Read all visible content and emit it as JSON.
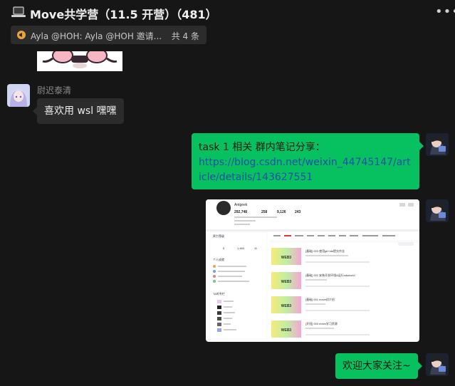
{
  "header": {
    "title": "Move共学营（11.5 开营）（481）",
    "icon": "laptop-icon",
    "more_icon": "more-icon"
  },
  "notice": {
    "text": "Ayla @HOH: Ayla @HOH 邀请...",
    "count": "共 4 条"
  },
  "messages": [
    {
      "side": "left",
      "sender": "尉迟泰清",
      "text": "喜欢用 wsl 嘿嘿"
    },
    {
      "side": "right",
      "text_prefix": "task 1 相关 群内笔记分享：",
      "link": "https://blog.csdn.net/weixin_44745147/article/details/143627551"
    },
    {
      "side": "right",
      "type": "image-screenshot"
    },
    {
      "side": "right",
      "text": "欢迎大家关注~"
    }
  ],
  "profile_shot": {
    "name": "Antgeek",
    "stats": [
      "292,748",
      "258",
      "9,126",
      "243"
    ],
    "posts": [
      "[基础] 003 使用git+ide提交作业",
      "[基础] 002 安装开发环境&运行sdsworld",
      "[基础] 001 move初介绍",
      "[开班] 000 move学习资源"
    ],
    "post_tag": "WEB3",
    "sidebar_labels": [
      "原力等级",
      "个人成就",
      "TA的专栏"
    ],
    "sidebar_values": [
      "5",
      "1,483",
      "11"
    ]
  },
  "colors": {
    "accent": "#07c160",
    "link": "#1a4fa8",
    "bubble_gray": "#2c2c2c",
    "background": "#161616"
  }
}
